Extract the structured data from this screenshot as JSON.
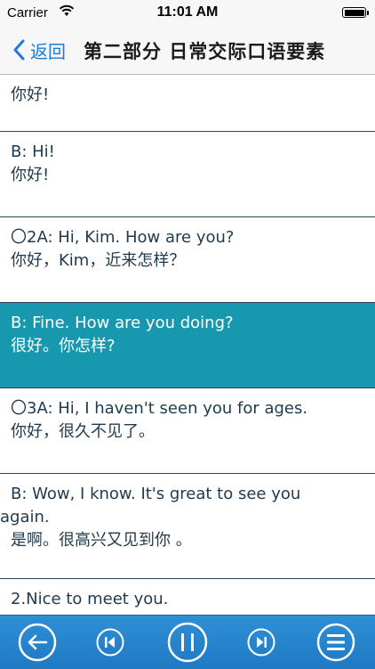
{
  "status_bar": {
    "carrier": "Carrier",
    "time": "11:01 AM"
  },
  "nav": {
    "back_label": "返回",
    "title": "第二部分 日常交际口语要素"
  },
  "rows": [
    {
      "lines": [
        "你好!"
      ]
    },
    {
      "lines": [
        "B: Hi!",
        "你好!"
      ]
    },
    {
      "lines": [
        "〇2A: Hi, Kim. How are you?",
        "你好，Kim，近来怎样？"
      ]
    },
    {
      "lines": [
        "B: Fine. How are you doing?",
        "很好。你怎样?"
      ],
      "selected": true
    },
    {
      "lines": [
        "〇3A: Hi, I haven't seen you for ages.",
        "你好，很久不见了。"
      ]
    },
    {
      "lines": [
        " B: Wow, I know. It's great to see you",
        "again.",
        " 是啊。很高兴又见到你 。"
      ]
    },
    {
      "lines": [
        "2.Nice to meet you."
      ]
    }
  ],
  "toolbar": {
    "buttons": [
      "back-circle-icon",
      "previous-track-icon",
      "pause-icon",
      "next-track-icon",
      "menu-list-icon"
    ]
  },
  "colors": {
    "accent": "#1f7ad8",
    "selected_row": "#1898ae",
    "toolbar": "#2386cd"
  }
}
